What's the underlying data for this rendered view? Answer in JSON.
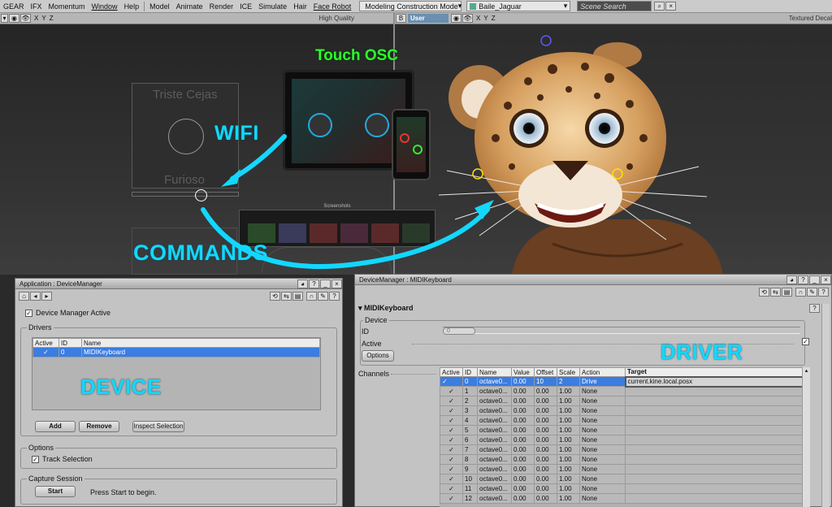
{
  "menubar": {
    "items": [
      "GEAR",
      "IFX",
      "Momentum",
      "Window",
      "Help",
      "Model",
      "Animate",
      "Render",
      "ICE",
      "Simulate",
      "Hair",
      "Face Robot"
    ],
    "mode": "Modeling Construction Mode",
    "scene": "Baile_Jaguar",
    "search_placeholder": "Scene Search"
  },
  "viewport_left": {
    "axes": [
      "X",
      "Y",
      "Z"
    ],
    "shading": "High Quality",
    "slider_labels": {
      "top": "Triste Cejas",
      "bottom": "Furioso"
    }
  },
  "viewport_right": {
    "camera": "User",
    "axes": [
      "X",
      "Y",
      "Z"
    ],
    "shading": "Textured Decal"
  },
  "tablet": {
    "screenshots_label": "Screenshots"
  },
  "annotations": {
    "touch_osc": "Touch OSC",
    "wifi": "WIFI",
    "commands": "COMMANDS",
    "device": "DEVICE",
    "driver": "DRIVER"
  },
  "device_manager": {
    "title": "Application : DeviceManager",
    "active_label": "Device Manager Active",
    "drivers_label": "Drivers",
    "drivers_columns": [
      "Active",
      "ID",
      "Name"
    ],
    "drivers_rows": [
      {
        "active": "✓",
        "id": "0",
        "name": "MIDIKeyboard"
      }
    ],
    "add": "Add",
    "remove": "Remove",
    "inspect": "Inspect Selection",
    "options_label": "Options",
    "track_selection": "Track Selection",
    "capture_label": "Capture Session",
    "start": "Start",
    "start_hint": "Press Start to begin."
  },
  "midi": {
    "title": "DeviceManager : MIDIKeyboard",
    "section": "MIDIKeyboard",
    "device_label": "Device",
    "id_label": "ID",
    "id_value": "0",
    "active_label": "Active",
    "options_button": "Options",
    "channels_label": "Channels",
    "columns": [
      "Active",
      "ID",
      "Name",
      "Value",
      "Offset",
      "Scale",
      "Action",
      "Target"
    ],
    "rows": [
      {
        "active": "✓",
        "id": "0",
        "name": "octave0...",
        "value": "0.00",
        "offset": "10",
        "scale": "2",
        "action": "Drive",
        "target": "current.kine.local.posx"
      },
      {
        "active": "✓",
        "id": "1",
        "name": "octave0...",
        "value": "0.00",
        "offset": "0.00",
        "scale": "1.00",
        "action": "None",
        "target": ""
      },
      {
        "active": "✓",
        "id": "2",
        "name": "octave0...",
        "value": "0.00",
        "offset": "0.00",
        "scale": "1.00",
        "action": "None",
        "target": ""
      },
      {
        "active": "✓",
        "id": "3",
        "name": "octave0...",
        "value": "0.00",
        "offset": "0.00",
        "scale": "1.00",
        "action": "None",
        "target": ""
      },
      {
        "active": "✓",
        "id": "4",
        "name": "octave0...",
        "value": "0.00",
        "offset": "0.00",
        "scale": "1.00",
        "action": "None",
        "target": ""
      },
      {
        "active": "✓",
        "id": "5",
        "name": "octave0...",
        "value": "0.00",
        "offset": "0.00",
        "scale": "1.00",
        "action": "None",
        "target": ""
      },
      {
        "active": "✓",
        "id": "6",
        "name": "octave0...",
        "value": "0.00",
        "offset": "0.00",
        "scale": "1.00",
        "action": "None",
        "target": ""
      },
      {
        "active": "✓",
        "id": "7",
        "name": "octave0...",
        "value": "0.00",
        "offset": "0.00",
        "scale": "1.00",
        "action": "None",
        "target": ""
      },
      {
        "active": "✓",
        "id": "8",
        "name": "octave0...",
        "value": "0.00",
        "offset": "0.00",
        "scale": "1.00",
        "action": "None",
        "target": ""
      },
      {
        "active": "✓",
        "id": "9",
        "name": "octave0...",
        "value": "0.00",
        "offset": "0.00",
        "scale": "1.00",
        "action": "None",
        "target": ""
      },
      {
        "active": "✓",
        "id": "10",
        "name": "octave0...",
        "value": "0.00",
        "offset": "0.00",
        "scale": "1.00",
        "action": "None",
        "target": ""
      },
      {
        "active": "✓",
        "id": "11",
        "name": "octave0...",
        "value": "0.00",
        "offset": "0.00",
        "scale": "1.00",
        "action": "None",
        "target": ""
      },
      {
        "active": "✓",
        "id": "12",
        "name": "octave0...",
        "value": "0.00",
        "offset": "0.00",
        "scale": "1.00",
        "action": "None",
        "target": ""
      }
    ]
  },
  "colors": {
    "accent": "#12d8ff",
    "selection": "#3b7de0"
  }
}
